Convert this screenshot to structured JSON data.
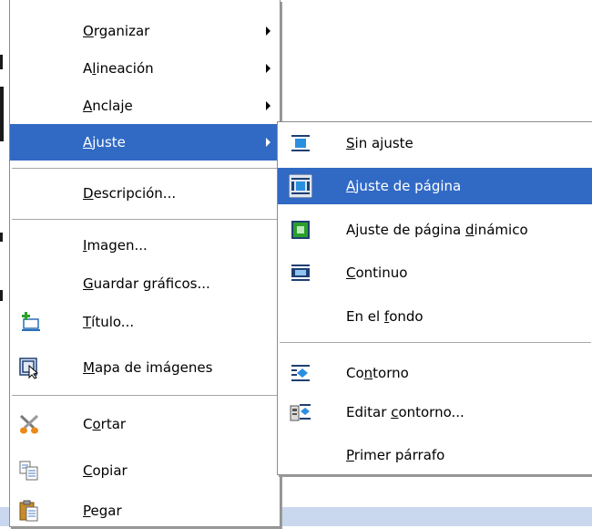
{
  "main_menu": {
    "items": [
      {
        "pre": "",
        "u": "O",
        "post": "rganizar"
      },
      {
        "pre": "A",
        "u": "l",
        "post": "ineación"
      },
      {
        "pre": "",
        "u": "A",
        "post": "nclaje"
      },
      {
        "pre": "",
        "u": "A",
        "post": "juste"
      },
      {
        "pre": "",
        "u": "D",
        "post": "escripción..."
      },
      {
        "pre": "",
        "u": "I",
        "post": "magen..."
      },
      {
        "pre": "",
        "u": "G",
        "post": "uardar gráficos..."
      },
      {
        "pre": "",
        "u": "T",
        "post": "ítulo..."
      },
      {
        "pre": "",
        "u": "M",
        "post": "apa de imágenes"
      },
      {
        "pre": "C",
        "u": "o",
        "post": "rtar"
      },
      {
        "pre": "",
        "u": "C",
        "post": "opiar"
      },
      {
        "pre": "",
        "u": "P",
        "post": "egar"
      }
    ],
    "icons": [
      "title-icon",
      "image-map-icon",
      "cut-scissors-icon",
      "copy-icon",
      "paste-icon"
    ],
    "highlight_color": "#316ac5"
  },
  "sub_menu": {
    "items": [
      {
        "pre": "",
        "u": "S",
        "post": "in ajuste"
      },
      {
        "pre": "",
        "u": "A",
        "post": "juste de página"
      },
      {
        "pre": "Ajuste de página ",
        "u": "d",
        "post": "inámico"
      },
      {
        "pre": "",
        "u": "C",
        "post": "ontinuo"
      },
      {
        "pre": "En el ",
        "u": "f",
        "post": "ondo"
      },
      {
        "pre": "Co",
        "u": "n",
        "post": "torno"
      },
      {
        "pre": "Editar ",
        "u": "c",
        "post": "ontorno..."
      },
      {
        "pre": "",
        "u": "P",
        "post": "rimer párrafo"
      }
    ],
    "icons": [
      "no-wrap-icon",
      "page-wrap-icon",
      "dynamic-page-wrap-icon",
      "continuous-wrap-icon",
      "contour-icon",
      "edit-contour-icon"
    ]
  }
}
